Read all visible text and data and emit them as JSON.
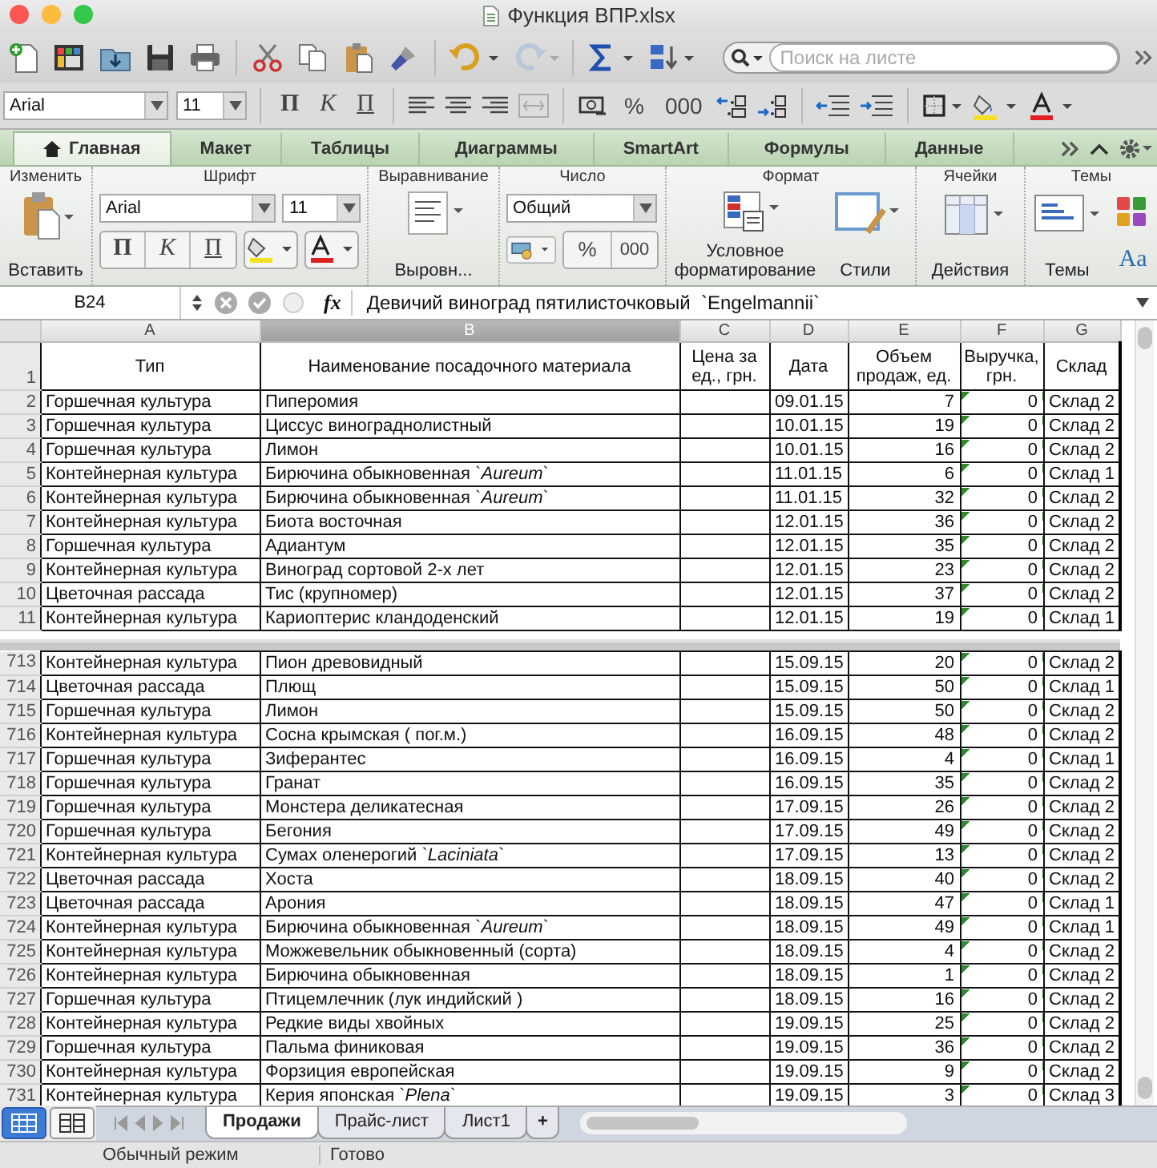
{
  "window": {
    "title": "Функция ВПР.xlsx"
  },
  "toolbar": {
    "search": {
      "placeholder": "Поиск на листе"
    }
  },
  "format_bar": {
    "font": "Arial",
    "size": "11",
    "style_buttons": [
      {
        "label": "П",
        "kind": "bold"
      },
      {
        "label": "К",
        "kind": "italic"
      },
      {
        "label": "П",
        "kind": "underline"
      }
    ],
    "number_buttons": [
      "%",
      "000"
    ]
  },
  "ribbon_tabs": [
    {
      "label": "Главная",
      "selected": true
    },
    {
      "label": "Макет",
      "selected": false
    },
    {
      "label": "Таблицы",
      "selected": false
    },
    {
      "label": "Диаграммы",
      "selected": false
    },
    {
      "label": "SmartArt",
      "selected": false
    },
    {
      "label": "Формулы",
      "selected": false
    },
    {
      "label": "Данные",
      "selected": false
    }
  ],
  "ribbon": {
    "edit": {
      "title": "Изменить",
      "paste": "Вставить"
    },
    "font": {
      "title": "Шрифт",
      "font": "Arial",
      "size": "11",
      "style_buttons": [
        {
          "label": "П",
          "kind": "bold"
        },
        {
          "label": "К",
          "kind": "italic"
        },
        {
          "label": "П",
          "kind": "underline"
        }
      ]
    },
    "alignment": {
      "title": "Выравнивание",
      "button": "Выровн..."
    },
    "number": {
      "title": "Число",
      "format": "Общий",
      "buttons": [
        "%",
        "000"
      ]
    },
    "format": {
      "title": "Формат",
      "conditional": "Условное форматирование",
      "styles": "Стили"
    },
    "cells": {
      "title": "Ячейки",
      "actions": "Действия"
    },
    "themes": {
      "title": "Темы",
      "themes": "Темы",
      "fonts": "Aa"
    }
  },
  "formula_bar": {
    "cell": "B24",
    "function_label": "fx",
    "formula": "Девичий виноград пятилисточковый  `Engelmannii`"
  },
  "sheet": {
    "columns": [
      {
        "letter": "A",
        "selected": false
      },
      {
        "letter": "B",
        "selected": true
      },
      {
        "letter": "C",
        "selected": false
      },
      {
        "letter": "D",
        "selected": false
      },
      {
        "letter": "E",
        "selected": false
      },
      {
        "letter": "F",
        "selected": false
      },
      {
        "letter": "G",
        "selected": false
      }
    ],
    "header_row": {
      "number": "1",
      "cells": [
        "Тип",
        "Наименование посадочного материала",
        "Цена за ед., грн.",
        "Дата",
        "Объем продаж, ед.",
        "Выручка, грн.",
        "Склад"
      ]
    },
    "panes": [
      {
        "rows": [
          {
            "number": "2",
            "type": "Горшечная культура",
            "name": "Пиперомия",
            "date": "09.01.15",
            "volume": "7",
            "revenue": "0",
            "warehouse": "Склад 2"
          },
          {
            "number": "3",
            "type": "Горшечная культура",
            "name": "Циссус винограднолистный",
            "date": "10.01.15",
            "volume": "19",
            "revenue": "0",
            "warehouse": "Склад 2"
          },
          {
            "number": "4",
            "type": "Горшечная культура",
            "name": "Лимон",
            "date": "10.01.15",
            "volume": "16",
            "revenue": "0",
            "warehouse": "Склад 2"
          },
          {
            "number": "5",
            "type": "Контейнерная культура",
            "name": "Бирючина обыкновенная  `*Aureum*`",
            "date": "11.01.15",
            "volume": "6",
            "revenue": "0",
            "warehouse": "Склад 1"
          },
          {
            "number": "6",
            "type": "Контейнерная культура",
            "name": "Бирючина обыкновенная  `*Aureum*`",
            "date": "11.01.15",
            "volume": "32",
            "revenue": "0",
            "warehouse": "Склад 2"
          },
          {
            "number": "7",
            "type": "Контейнерная культура",
            "name": "Биота восточная",
            "date": "12.01.15",
            "volume": "36",
            "revenue": "0",
            "warehouse": "Склад 2"
          },
          {
            "number": "8",
            "type": "Горшечная культура",
            "name": "Адиантум",
            "date": "12.01.15",
            "volume": "35",
            "revenue": "0",
            "warehouse": "Склад 2"
          },
          {
            "number": "9",
            "type": "Контейнерная культура",
            "name": "Виноград сортовой 2-х лет",
            "date": "12.01.15",
            "volume": "23",
            "revenue": "0",
            "warehouse": "Склад 2"
          },
          {
            "number": "10",
            "type": "Цветочная рассада",
            "name": "Тис (крупномер)",
            "date": "12.01.15",
            "volume": "37",
            "revenue": "0",
            "warehouse": "Склад 2"
          },
          {
            "number": "11",
            "type": "Контейнерная культура",
            "name": "Кариоптерис кландоденский",
            "date": "12.01.15",
            "volume": "19",
            "revenue": "0",
            "warehouse": "Склад 1"
          }
        ]
      },
      {
        "rows": [
          {
            "number": "713",
            "type": "Контейнерная культура",
            "name": "Пион древовидный",
            "date": "15.09.15",
            "volume": "20",
            "revenue": "0",
            "warehouse": "Склад 2"
          },
          {
            "number": "714",
            "type": "Цветочная рассада",
            "name": "Плющ",
            "date": "15.09.15",
            "volume": "50",
            "revenue": "0",
            "warehouse": "Склад 1"
          },
          {
            "number": "715",
            "type": "Горшечная культура",
            "name": "Лимон",
            "date": "15.09.15",
            "volume": "50",
            "revenue": "0",
            "warehouse": "Склад 2"
          },
          {
            "number": "716",
            "type": "Контейнерная культура",
            "name": "Сосна крымская ( пог.м.)",
            "date": "16.09.15",
            "volume": "48",
            "revenue": "0",
            "warehouse": "Склад 2"
          },
          {
            "number": "717",
            "type": "Горшечная культура",
            "name": "Зиферантес",
            "date": "16.09.15",
            "volume": "4",
            "revenue": "0",
            "warehouse": "Склад 1"
          },
          {
            "number": "718",
            "type": "Горшечная культура",
            "name": "Гранат",
            "date": "16.09.15",
            "volume": "35",
            "revenue": "0",
            "warehouse": "Склад 2"
          },
          {
            "number": "719",
            "type": "Горшечная культура",
            "name": "Монстера деликатесная",
            "date": "17.09.15",
            "volume": "26",
            "revenue": "0",
            "warehouse": "Склад 2"
          },
          {
            "number": "720",
            "type": "Горшечная культура",
            "name": "Бегония",
            "date": "17.09.15",
            "volume": "49",
            "revenue": "0",
            "warehouse": "Склад 2"
          },
          {
            "number": "721",
            "type": "Контейнерная культура",
            "name": "Сумах оленерогий `*Laciniata*`",
            "date": "17.09.15",
            "volume": "13",
            "revenue": "0",
            "warehouse": "Склад 2"
          },
          {
            "number": "722",
            "type": "Цветочная рассада",
            "name": "Хоста",
            "date": "18.09.15",
            "volume": "40",
            "revenue": "0",
            "warehouse": "Склад 2"
          },
          {
            "number": "723",
            "type": "Цветочная рассада",
            "name": "Арония",
            "date": "18.09.15",
            "volume": "47",
            "revenue": "0",
            "warehouse": "Склад 1"
          },
          {
            "number": "724",
            "type": "Контейнерная культура",
            "name": "Бирючина обыкновенная  `*Aureum*`",
            "date": "18.09.15",
            "volume": "49",
            "revenue": "0",
            "warehouse": "Склад 1"
          },
          {
            "number": "725",
            "type": "Контейнерная культура",
            "name": "Можжевельник обыкновенный (сорта)",
            "date": "18.09.15",
            "volume": "4",
            "revenue": "0",
            "warehouse": "Склад 2"
          },
          {
            "number": "726",
            "type": "Контейнерная культура",
            "name": "Бирючина обыкновенная",
            "date": "18.09.15",
            "volume": "1",
            "revenue": "0",
            "warehouse": "Склад 2"
          },
          {
            "number": "727",
            "type": "Горшечная культура",
            "name": "Птицемлечник (лук индийский )",
            "date": "18.09.15",
            "volume": "16",
            "revenue": "0",
            "warehouse": "Склад 2"
          },
          {
            "number": "728",
            "type": "Контейнерная культура",
            "name": "Редкие виды хвойных",
            "date": "19.09.15",
            "volume": "25",
            "revenue": "0",
            "warehouse": "Склад 2"
          },
          {
            "number": "729",
            "type": "Горшечная культура",
            "name": "Пальма финиковая",
            "date": "19.09.15",
            "volume": "36",
            "revenue": "0",
            "warehouse": "Склад 2"
          },
          {
            "number": "730",
            "type": "Контейнерная культура",
            "name": "Форзиция европейская",
            "date": "19.09.15",
            "volume": "9",
            "revenue": "0",
            "warehouse": "Склад 2"
          },
          {
            "number": "731",
            "type": "Контейнерная культура",
            "name": "Керия японская `*Plena*`",
            "date": "19.09.15",
            "volume": "3",
            "revenue": "0",
            "warehouse": "Склад 3"
          }
        ]
      }
    ]
  },
  "view_buttons": [
    {
      "kind": "normal",
      "selected": true
    },
    {
      "kind": "layout",
      "selected": false
    }
  ],
  "sheet_tabs": [
    {
      "label": "Продажи",
      "selected": true
    },
    {
      "label": "Прайс-лист",
      "selected": false
    },
    {
      "label": "Лист1",
      "selected": false
    }
  ],
  "add_sheet": "+",
  "status_bar": {
    "view_mode": "Обычный режим",
    "state": "Готово"
  }
}
